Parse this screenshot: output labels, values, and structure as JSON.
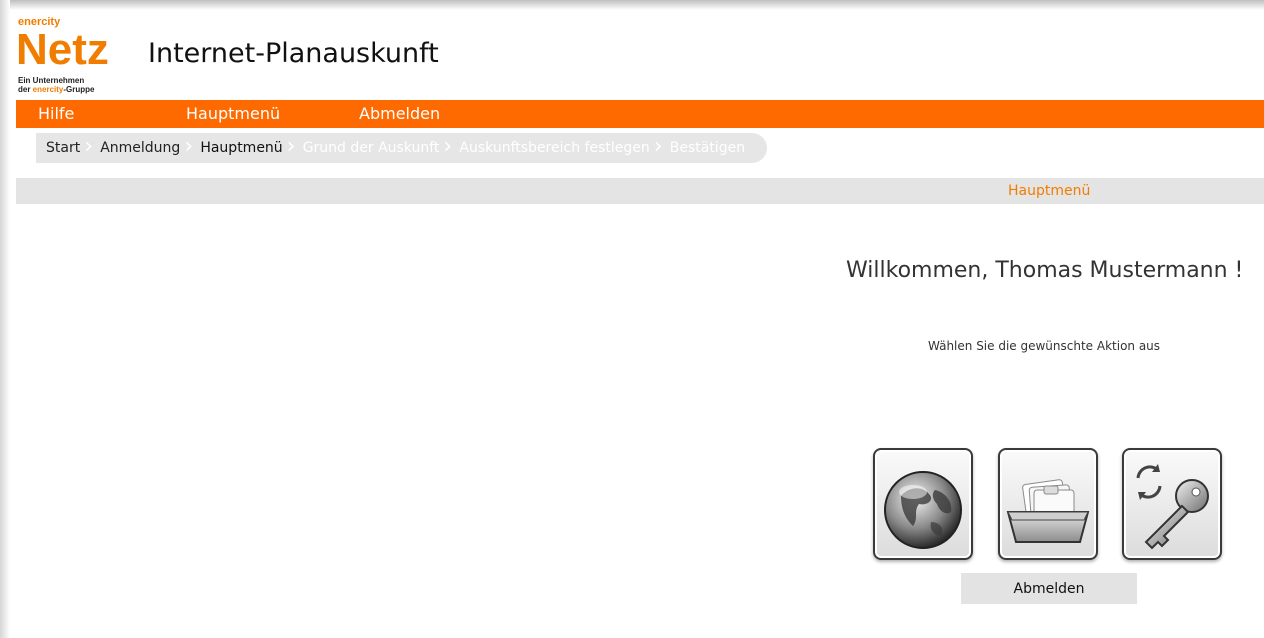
{
  "header": {
    "logo": {
      "small": "enercity",
      "big": "Netz",
      "tagline_line1": "Ein Unternehmen",
      "tagline_line2_prefix": "der ",
      "tagline_line2_accent": "enercity",
      "tagline_line2_suffix": "-Gruppe"
    },
    "title": "Internet-Planauskunft"
  },
  "menubar": {
    "items": [
      {
        "label": "Hilfe"
      },
      {
        "label": "Hauptmenü"
      },
      {
        "label": "Abmelden"
      }
    ]
  },
  "breadcrumb": {
    "items": [
      {
        "label": "Start",
        "state": "done"
      },
      {
        "label": "Anmeldung",
        "state": "done"
      },
      {
        "label": "Hauptmenü",
        "state": "current"
      },
      {
        "label": "Grund der Auskunft",
        "state": "disabled"
      },
      {
        "label": "Auskunftsbereich festlegen",
        "state": "disabled"
      },
      {
        "label": "Bestätigen",
        "state": "disabled"
      }
    ]
  },
  "section": {
    "title": "Hauptmenü"
  },
  "main": {
    "welcome": "Willkommen, Thomas Mustermann !",
    "instruction": "Wählen Sie die gewünschte Aktion aus",
    "actions": [
      {
        "icon": "globe-icon"
      },
      {
        "icon": "card-file-icon"
      },
      {
        "icon": "key-refresh-icon"
      }
    ],
    "logout_label": "Abmelden"
  },
  "colors": {
    "accent": "#ff6a00",
    "brand_orange": "#f07d00",
    "bar_gray": "#e4e4e4"
  }
}
